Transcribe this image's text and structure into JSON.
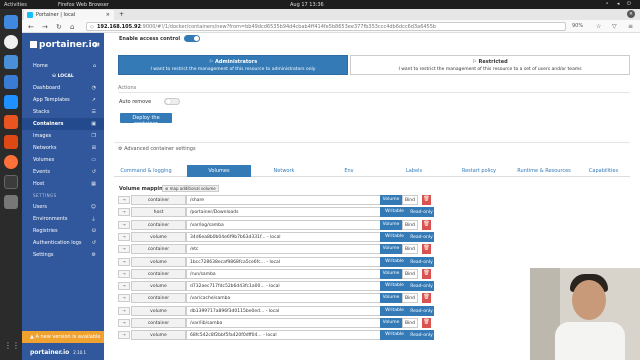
{
  "os": {
    "activities": "Activities",
    "app": "Firefox Web Browser",
    "clock": "Aug 17  13:36"
  },
  "browser": {
    "tab_title": "Portainer | local",
    "url_host": "192.168.105.92",
    "url_rest": ":9000/#!/1/docker/containers/new?from=bb49dcd6535b94d4cbab4ff414fe5b8653ee377fb353ccc4db6dcc6d3a6455b",
    "zoom": "90%"
  },
  "sidebar": {
    "logo": "portainer.io",
    "home": "Home",
    "endpoint": "LOCAL",
    "items": [
      {
        "label": "Dashboard",
        "icon": "gauge-icon"
      },
      {
        "label": "App Templates",
        "icon": "rocket-icon"
      },
      {
        "label": "Stacks",
        "icon": "th-list-icon"
      },
      {
        "label": "Containers",
        "icon": "cubes-icon"
      },
      {
        "label": "Images",
        "icon": "clone-icon"
      },
      {
        "label": "Networks",
        "icon": "sitemap-icon"
      },
      {
        "label": "Volumes",
        "icon": "hdd-icon"
      },
      {
        "label": "Events",
        "icon": "history-icon"
      },
      {
        "label": "Host",
        "icon": "th-icon"
      }
    ],
    "settings_head": "SETTINGS",
    "settings": [
      {
        "label": "Users",
        "icon": "users-icon"
      },
      {
        "label": "Environments",
        "icon": "plug-icon"
      },
      {
        "label": "Registries",
        "icon": "database-icon"
      },
      {
        "label": "Authentication logs",
        "icon": "history-icon"
      },
      {
        "label": "Settings",
        "icon": "cogs-icon"
      }
    ],
    "update": "A new version is available",
    "footer_logo": "portainer.io",
    "version": "2.10.1"
  },
  "main": {
    "access_label": "Enable access control",
    "admins_title": "Administrators",
    "admins_desc": "I want to restrict the management of this resource to administrators only",
    "restricted_title": "Restricted",
    "restricted_desc": "I want to restrict the management of this resource to a set of users and/or teams",
    "actions": "Actions",
    "auto_remove": "Auto remove",
    "deploy": "Deploy the container",
    "advanced": "Advanced container settings",
    "tabs": [
      "Command & logging",
      "Volumes",
      "Network",
      "Env",
      "Labels",
      "Restart policy",
      "Runtime & Resources",
      "Capabilities"
    ],
    "volume_mapping": "Volume mapping",
    "map_volume": "map additional volume",
    "rows": [
      {
        "kind": "container",
        "value": "/share",
        "b1": "Volume",
        "b2": "Bind",
        "v": false
      },
      {
        "kind": "host",
        "value": "/portainer/Downloads",
        "b1": "Writable",
        "b2": "Read-only",
        "v": true
      },
      {
        "kind": "container",
        "value": "/var/log/samba",
        "b1": "Volume",
        "b2": "Bind",
        "v": false
      },
      {
        "kind": "volume",
        "value": "34d6ea8b0b04e6f9b7b63d331f... - local",
        "b1": "Writable",
        "b2": "Read-only",
        "v": true
      },
      {
        "kind": "container",
        "value": "/etc",
        "b1": "Volume",
        "b2": "Bind",
        "v": false
      },
      {
        "kind": "volume",
        "value": "1bcc728638ecaf9868fca5ce6fc... - local",
        "b1": "Writable",
        "b2": "Read-only",
        "v": true
      },
      {
        "kind": "container",
        "value": "/run/samba",
        "b1": "Volume",
        "b2": "Bind",
        "v": false
      },
      {
        "kind": "volume",
        "value": "d732aec717fdc52b6d43fc1a00... - local",
        "b1": "Writable",
        "b2": "Read-only",
        "v": true
      },
      {
        "kind": "container",
        "value": "/var/cache/samba",
        "b1": "Volume",
        "b2": "Bind",
        "v": false
      },
      {
        "kind": "volume",
        "value": "db1399717a896f3d0115be0ed... - local",
        "b1": "Writable",
        "b2": "Read-only",
        "v": true
      },
      {
        "kind": "container",
        "value": "/var/lib/samba",
        "b1": "Volume",
        "b2": "Bind",
        "v": false
      },
      {
        "kind": "volume",
        "value": "68fc542c8f2bbf5fa420f0dff04... - local",
        "b1": "Writable",
        "b2": "Read-only",
        "v": true
      }
    ]
  }
}
